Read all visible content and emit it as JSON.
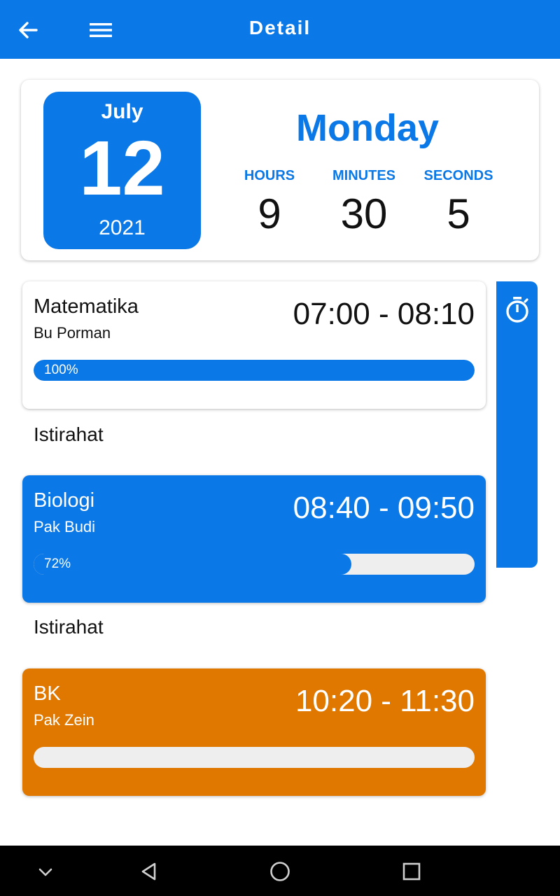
{
  "appbar": {
    "title": "Detail",
    "back_icon": "arrow-left-icon",
    "menu_icon": "hamburger-menu-icon"
  },
  "date": {
    "month": "July",
    "day": "12",
    "year": "2021",
    "weekday": "Monday"
  },
  "time": {
    "hours_label": "HOURS",
    "hours": "9",
    "minutes_label": "MINUTES",
    "minutes": "30",
    "seconds_label": "SECONDS",
    "seconds": "5"
  },
  "schedule": [
    {
      "subject": "Matematika",
      "teacher": "Bu Porman",
      "time_range": "07:00 - 08:10",
      "progress": 1.0,
      "progress_label": "100%",
      "color": "#ffffff"
    },
    {
      "subject": "Biologi",
      "teacher": "Pak Budi",
      "time_range": "08:40 - 09:50",
      "progress": 0.72,
      "progress_label": "72%",
      "color": "#0a78e6"
    },
    {
      "subject": "BK",
      "teacher": "Pak Zein",
      "time_range": "10:20 - 11:30",
      "progress": 0,
      "progress_label": "",
      "color": "#e07800"
    }
  ],
  "breaks": [
    "Istirahat",
    "Istirahat"
  ],
  "sidebar": {
    "icon": "stopwatch-icon"
  },
  "navbar": {
    "icons": [
      "chevron-down-icon",
      "back-triangle-icon",
      "home-circle-icon",
      "recents-square-icon"
    ]
  },
  "colors": {
    "primary": "#0a78e6",
    "accent_orange": "#e07800",
    "track": "#eeeeee"
  }
}
